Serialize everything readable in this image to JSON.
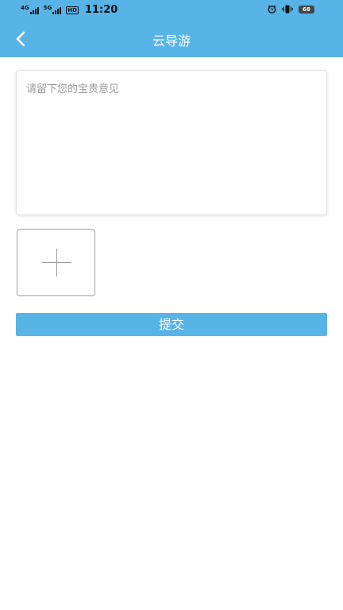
{
  "status_bar": {
    "network_1": "4G",
    "network_2": "5G",
    "hd_badge": "HD",
    "time": "11:20",
    "battery": "68",
    "icons": [
      "alarm-icon",
      "vibrate-icon",
      "battery-icon"
    ]
  },
  "header": {
    "title": "云导游",
    "back_icon": "chevron-left-icon"
  },
  "feedback": {
    "placeholder": "请留下您的宝贵意见",
    "value": ""
  },
  "add_photo": {
    "icon": "plus-icon"
  },
  "submit_label": "提交",
  "colors": {
    "primary": "#58b3e7",
    "placeholder": "#9a9a9a",
    "border": "#9f9f9f"
  }
}
